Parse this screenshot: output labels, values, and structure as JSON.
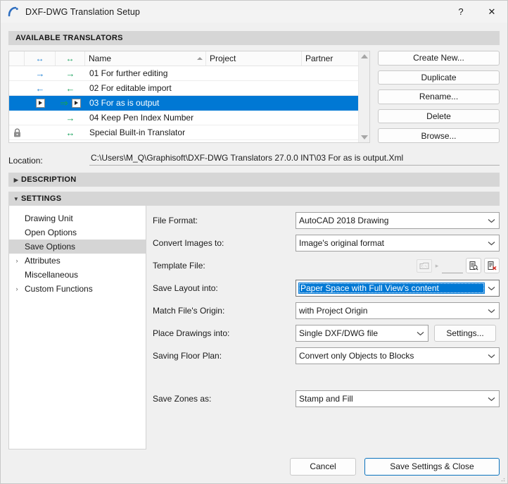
{
  "window": {
    "title": "DXF-DWG Translation Setup",
    "logo_icon": "archicad-arc-icon",
    "help_label": "?",
    "close_label": "✕",
    "accent_color": "#0078d4",
    "default_button_border": "#0a72bd"
  },
  "available_translators": {
    "section_title": "AVAILABLE TRANSLATORS",
    "columns": [
      "",
      "↔",
      "↔",
      "Name",
      "Project",
      "Partner"
    ],
    "sort_column": "Name",
    "sort_direction": "ascending",
    "rows": [
      {
        "lock": "",
        "import_arrow": "→",
        "export_arrow": "→",
        "name": "01 For further editing",
        "project": "",
        "partner": "",
        "selected": false
      },
      {
        "lock": "",
        "import_arrow": "←",
        "export_arrow": "←",
        "name": "02 For editable import",
        "project": "",
        "partner": "",
        "selected": false
      },
      {
        "lock": "",
        "import_arrow": "play-box",
        "export_arrow": "⇒",
        "name": "03 For as is output",
        "project": "",
        "partner": "",
        "selected": true
      },
      {
        "lock": "",
        "import_arrow": "",
        "export_arrow": "→",
        "name": "04 Keep Pen Index Number",
        "project": "",
        "partner": "",
        "selected": false
      },
      {
        "lock": "lock-icon",
        "import_arrow": "",
        "export_arrow": "↔",
        "name": "Special Built-in Translator",
        "project": "",
        "partner": "",
        "selected": false
      }
    ],
    "buttons": [
      {
        "label": "Create New...",
        "name": "create-new-button"
      },
      {
        "label": "Duplicate",
        "name": "duplicate-button"
      },
      {
        "label": "Rename...",
        "name": "rename-button"
      },
      {
        "label": "Delete",
        "name": "delete-button"
      },
      {
        "label": "Browse...",
        "name": "browse-button"
      }
    ]
  },
  "location": {
    "label": "Location:",
    "value": "C:\\Users\\M_Q\\Graphisoft\\DXF-DWG Translators 27.0.0 INT\\03 For as is output.Xml"
  },
  "description": {
    "title": "DESCRIPTION",
    "expanded": false,
    "triangle": "▶"
  },
  "settings": {
    "title": "SETTINGS",
    "expanded": true,
    "triangle": "▼",
    "tree": [
      {
        "label": "Drawing Unit",
        "chevron": "",
        "selected": false
      },
      {
        "label": "Open Options",
        "chevron": "",
        "selected": false
      },
      {
        "label": "Save Options",
        "chevron": "",
        "selected": true
      },
      {
        "label": "Attributes",
        "chevron": "›",
        "selected": false
      },
      {
        "label": "Miscellaneous",
        "chevron": "",
        "selected": false
      },
      {
        "label": "Custom Functions",
        "chevron": "›",
        "selected": false
      }
    ],
    "fields": {
      "file_format": {
        "label": "File Format:",
        "value": "AutoCAD 2018 Drawing"
      },
      "convert_images": {
        "label": "Convert Images to:",
        "value": "Image's original format"
      },
      "template_file": {
        "label": "Template File:",
        "value": "",
        "placeholder": "",
        "folder_icon": "folder-path-icon",
        "expand_icon": "chevron-right-icon",
        "browse_icon": "document-search-icon",
        "clear_icon": "document-delete-icon"
      },
      "save_layout_into": {
        "label": "Save Layout into:",
        "value": "Paper Space with Full View's content",
        "focused": true
      },
      "match_file_origin": {
        "label": "Match File's Origin:",
        "value": "with Project Origin"
      },
      "place_drawings_into": {
        "label": "Place Drawings into:",
        "value": "Single DXF/DWG file",
        "settings_button": "Settings..."
      },
      "saving_floor_plan": {
        "label": "Saving Floor Plan:",
        "value": "Convert only Objects to Blocks"
      },
      "save_zones_as": {
        "label": "Save Zones as:",
        "value": "Stamp and Fill"
      }
    }
  },
  "footer": {
    "cancel_label": "Cancel",
    "save_close_label": "Save Settings & Close"
  }
}
